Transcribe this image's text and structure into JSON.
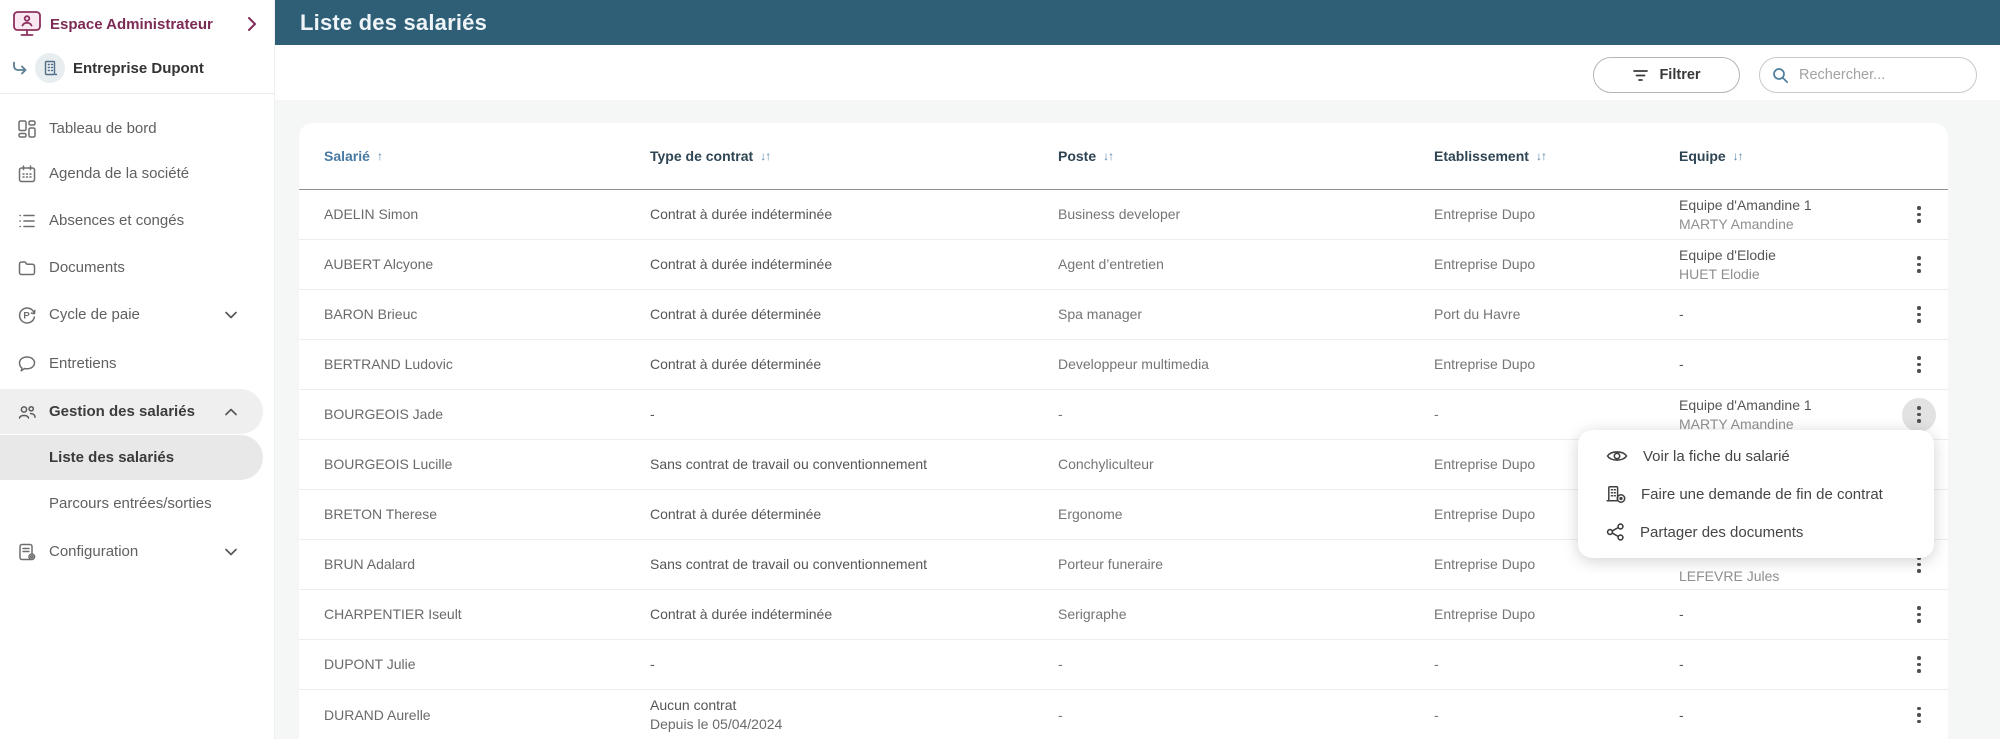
{
  "brand": {
    "workspace_label": "Espace Administrateur",
    "company_name": "Entreprise Dupont"
  },
  "header": {
    "title": "Liste des salariés"
  },
  "toolbar": {
    "filter_label": "Filtrer",
    "search_placeholder": "Rechercher..."
  },
  "sidebar": {
    "items": [
      {
        "label": "Tableau de bord"
      },
      {
        "label": "Agenda de la société"
      },
      {
        "label": "Absences et congés"
      },
      {
        "label": "Documents"
      },
      {
        "label": "Cycle de paie",
        "expandable": "collapsed"
      },
      {
        "label": "Entretiens"
      },
      {
        "label": "Gestion des salariés",
        "expandable": "expanded",
        "active": true
      },
      {
        "label": "Liste des salariés",
        "sub_item": true,
        "active": true
      },
      {
        "label": "Parcours entrées/sorties",
        "sub_item": true
      },
      {
        "label": "Configuration",
        "expandable": "collapsed"
      }
    ]
  },
  "table": {
    "columns": [
      {
        "label": "Salarié",
        "sort_icon": "↑",
        "active": true
      },
      {
        "label": "Type de contrat",
        "sort_icon": "↓↑"
      },
      {
        "label": "Poste",
        "sort_icon": "↓↑"
      },
      {
        "label": "Etablissement",
        "sort_icon": "↓↑"
      },
      {
        "label": "Equipe",
        "sort_icon": "↓↑"
      }
    ],
    "rows": [
      {
        "name": "ADELIN Simon",
        "contract": "Contrat à durée indéterminée",
        "contract_sub": "",
        "poste": "Business developer",
        "etablissement": "Entreprise Dupo",
        "equipe_team": "Equipe d'Amandine 1",
        "equipe_manager": "MARTY Amandine"
      },
      {
        "name": "AUBERT Alcyone",
        "contract": "Contrat à durée indéterminée",
        "contract_sub": "",
        "poste": "Agent d’entretien",
        "etablissement": "Entreprise Dupo",
        "equipe_team": "Equipe d'Elodie",
        "equipe_manager": "HUET Elodie"
      },
      {
        "name": "BARON Brieuc",
        "contract": "Contrat à durée déterminée",
        "contract_sub": "",
        "poste": "Spa manager",
        "etablissement": "Port du Havre",
        "equipe_team": "-",
        "equipe_manager": ""
      },
      {
        "name": "BERTRAND Ludovic",
        "contract": "Contrat à durée déterminée",
        "contract_sub": "",
        "poste": "Developpeur multimedia",
        "etablissement": "Entreprise Dupo",
        "equipe_team": "-",
        "equipe_manager": ""
      },
      {
        "name": "BOURGEOIS Jade",
        "contract": "-",
        "contract_sub": "",
        "poste": "-",
        "etablissement": "-",
        "equipe_team": "Equipe d'Amandine 1",
        "equipe_manager": "MARTY Amandine",
        "menu_open": true
      },
      {
        "name": "BOURGEOIS Lucille",
        "contract": "Sans contrat de travail ou conventionnement",
        "contract_sub": "",
        "poste": "Conchyliculteur",
        "etablissement": "Entreprise Dupo",
        "equipe_team": "",
        "equipe_manager": ""
      },
      {
        "name": "BRETON Therese",
        "contract": "Contrat à durée déterminée",
        "contract_sub": "",
        "poste": "Ergonome",
        "etablissement": "Entreprise Dupo",
        "equipe_team": "",
        "equipe_manager": ""
      },
      {
        "name": "BRUN Adalard",
        "contract": "Sans contrat de travail ou conventionnement",
        "contract_sub": "",
        "poste": "Porteur funeraire",
        "etablissement": "Entreprise Dupo",
        "equipe_team": "",
        "equipe_manager": "LEFEVRE Jules"
      },
      {
        "name": "CHARPENTIER Iseult",
        "contract": "Contrat à durée indéterminée",
        "contract_sub": "",
        "poste": "Serigraphe",
        "etablissement": "Entreprise Dupo",
        "equipe_team": "-",
        "equipe_manager": ""
      },
      {
        "name": "DUPONT Julie",
        "contract": "-",
        "contract_sub": "",
        "poste": "-",
        "etablissement": "-",
        "equipe_team": "-",
        "equipe_manager": ""
      },
      {
        "name": "DURAND Aurelle",
        "contract": "Aucun contrat",
        "contract_sub": "Depuis le 05/04/2024",
        "poste": "-",
        "etablissement": "-",
        "equipe_team": "-",
        "equipe_manager": ""
      }
    ]
  },
  "context_menu": {
    "items": [
      {
        "label": "Voir la fiche du salarié",
        "icon": "eye-icon"
      },
      {
        "label": "Faire une demande de fin de contrat",
        "icon": "end-contract-icon"
      },
      {
        "label": "Partager des documents",
        "icon": "share-icon"
      }
    ]
  },
  "colors": {
    "topbar_teal": "#2e5f76",
    "brand_maroon": "#7c2b55",
    "brand_icon_stroke": "#8d3060",
    "brand_icon_fill": "#f9e8f1",
    "sort_blue": "#5685a8",
    "active_header_blue": "#4879a3",
    "header_navy": "#2e4453",
    "page_bg": "#f5f6f6",
    "pill_bg": "#ececec",
    "search_icon_blue": "#4e7e9d"
  }
}
